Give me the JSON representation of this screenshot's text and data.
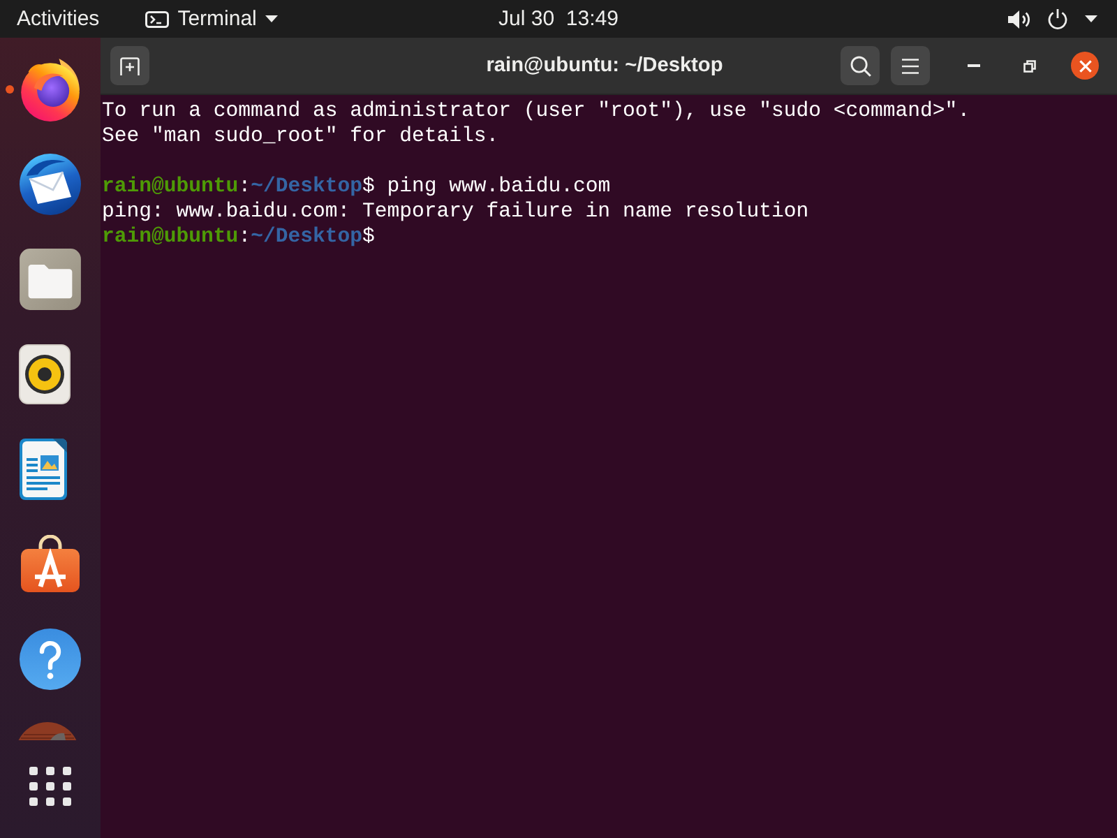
{
  "top_bar": {
    "activities": "Activities",
    "app_menu": "Terminal",
    "clock": "Jul 30  13:49"
  },
  "dock": {
    "items": [
      {
        "kind": "browser",
        "running": true
      },
      {
        "kind": "mail",
        "running": false
      },
      {
        "kind": "files",
        "running": false
      },
      {
        "kind": "music",
        "running": false
      },
      {
        "kind": "writer",
        "running": false
      },
      {
        "kind": "store",
        "running": false
      },
      {
        "kind": "help",
        "running": false
      },
      {
        "kind": "partial",
        "running": false
      }
    ]
  },
  "window": {
    "title": "rain@ubuntu: ~/Desktop"
  },
  "terminal": {
    "lines": [
      {
        "kind": "text",
        "segments": [
          {
            "kind": "plain",
            "text": "To run a command as administrator (user \"root\"), use \"sudo <command>\"."
          }
        ]
      },
      {
        "kind": "text",
        "segments": [
          {
            "kind": "plain",
            "text": "See \"man sudo_root\" for details."
          }
        ]
      },
      {
        "kind": "blank"
      },
      {
        "kind": "text",
        "segments": [
          {
            "kind": "user",
            "text": "rain@ubuntu"
          },
          {
            "kind": "plain",
            "text": ":"
          },
          {
            "kind": "path",
            "text": "~/Desktop"
          },
          {
            "kind": "plain",
            "text": "$ ping www.baidu.com"
          }
        ]
      },
      {
        "kind": "text",
        "segments": [
          {
            "kind": "plain",
            "text": "ping: www.baidu.com: Temporary failure in name resolution"
          }
        ]
      },
      {
        "kind": "text",
        "segments": [
          {
            "kind": "user",
            "text": "rain@ubuntu"
          },
          {
            "kind": "plain",
            "text": ":"
          },
          {
            "kind": "path",
            "text": "~/Desktop"
          },
          {
            "kind": "plain",
            "text": "$"
          }
        ]
      }
    ]
  }
}
